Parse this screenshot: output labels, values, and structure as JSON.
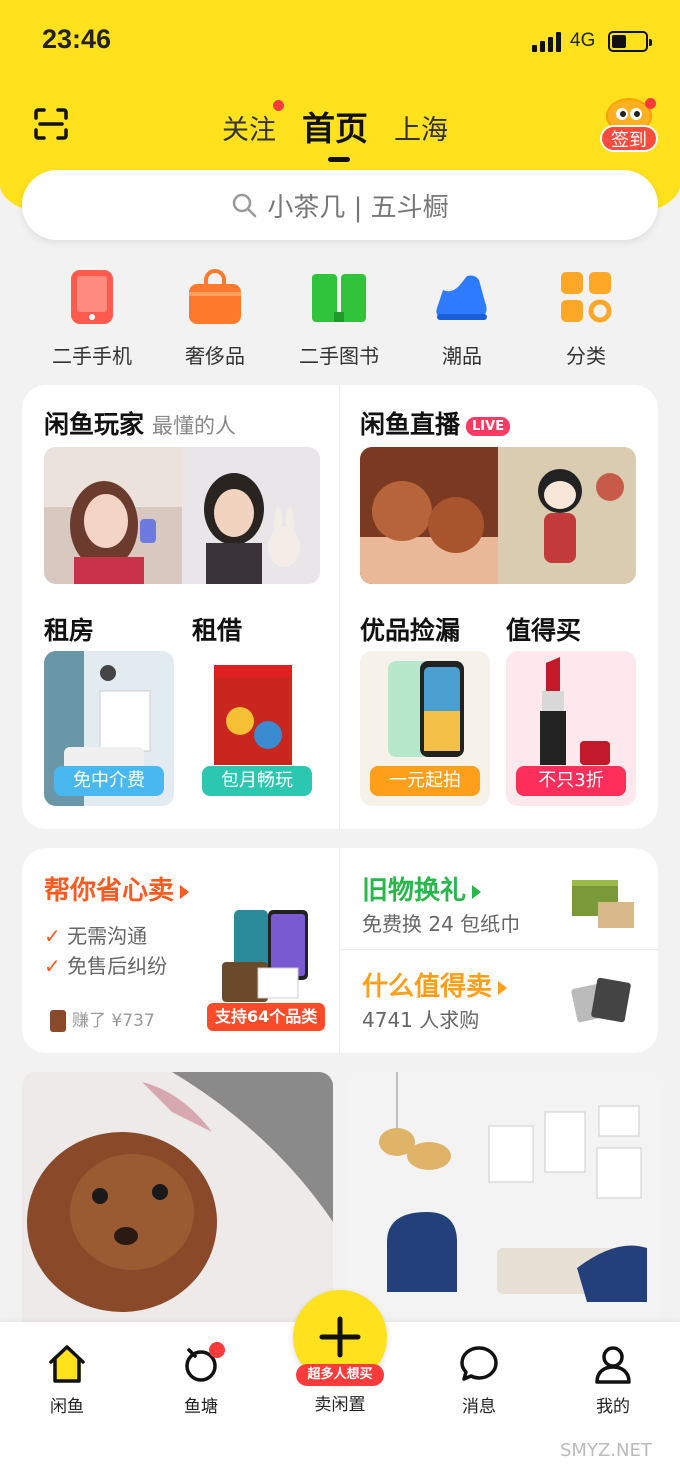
{
  "status_bar": {
    "time": "23:46",
    "network": "4G"
  },
  "header": {
    "tabs": [
      {
        "label": "关注",
        "has_dot": true
      },
      {
        "label": "首页",
        "active": true
      },
      {
        "label": "上海"
      }
    ],
    "signin_label": "签到"
  },
  "search": {
    "placeholder": "小茶几 | 五斗橱"
  },
  "categories": [
    {
      "label": "二手手机",
      "icon": "phone-icon",
      "color": "#ff5a4e"
    },
    {
      "label": "奢侈品",
      "icon": "bag-icon",
      "color": "#ff7a2a"
    },
    {
      "label": "二手图书",
      "icon": "book-icon",
      "color": "#2fc43c"
    },
    {
      "label": "潮品",
      "icon": "sneaker-icon",
      "color": "#2f7bff"
    },
    {
      "label": "分类",
      "icon": "grid-icon",
      "color": "#ffa726"
    }
  ],
  "feature": {
    "players": {
      "title": "闲鱼玩家",
      "subtitle": "最懂的人"
    },
    "live": {
      "title": "闲鱼直播",
      "badge": "LIVE"
    },
    "rent": {
      "title": "租房",
      "tag": "免中介费"
    },
    "borrow": {
      "title": "租借",
      "tag": "包月畅玩"
    },
    "picks": {
      "title": "优品捡漏",
      "tag": "一元起拍"
    },
    "worth": {
      "title": "值得买",
      "tag": "不只3折"
    }
  },
  "sell": {
    "title": "帮你省心卖",
    "points": [
      "无需沟通",
      "免售后纠纷"
    ],
    "earned": "赚了 ¥737",
    "badge": "支持64个品类"
  },
  "exchange": {
    "title": "旧物换礼",
    "subtitle": "免费换 24 包纸巾"
  },
  "worth_sell": {
    "title": "什么值得卖",
    "subtitle": "4741 人求购"
  },
  "tabbar": {
    "items": [
      {
        "label": "闲鱼",
        "icon": "home-icon"
      },
      {
        "label": "鱼塘",
        "icon": "pond-icon"
      },
      {
        "label": "卖闲置",
        "icon": "plus-icon"
      },
      {
        "label": "消息",
        "icon": "message-icon"
      },
      {
        "label": "我的",
        "icon": "profile-icon"
      }
    ],
    "sell_badge": "超多人想买"
  },
  "watermark": "SMYZ.NET",
  "colors": {
    "brand": "#ffe11d",
    "red": "#ff3b3b",
    "orange": "#ff6a1a",
    "green": "#27b84a",
    "worth_orange": "#ff9f1a"
  }
}
